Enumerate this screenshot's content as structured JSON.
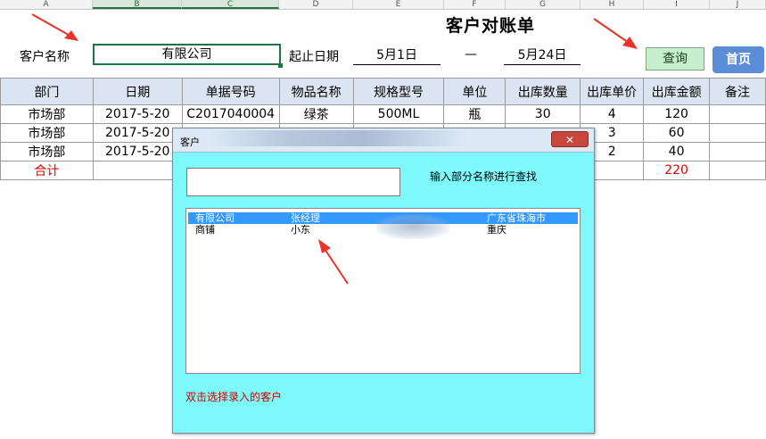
{
  "sheet": {
    "columns": [
      "A",
      "B",
      "C",
      "D",
      "E",
      "F",
      "G",
      "H",
      "I",
      "J"
    ],
    "selected_columns": [
      "B",
      "C"
    ]
  },
  "report": {
    "title": "客户对账单",
    "customer_label": "客户名称",
    "customer_value": "有限公司",
    "date_label": "起止日期",
    "date_start": "5月1日",
    "date_sep": "—",
    "date_end": "5月24日",
    "query_button": "查询",
    "home_button": "首页"
  },
  "table": {
    "headers": [
      "部门",
      "日期",
      "单据号码",
      "物品名称",
      "规格型号",
      "单位",
      "出库数量",
      "出库单价",
      "出库金额",
      "备注"
    ],
    "rows": [
      [
        "市场部",
        "2017-5-20",
        "C2017040004",
        "绿茶",
        "500ML",
        "瓶",
        "30",
        "4",
        "120",
        ""
      ],
      [
        "市场部",
        "2017-5-20",
        "",
        "",
        "",
        "",
        "",
        "3",
        "60",
        ""
      ],
      [
        "市场部",
        "2017-5-20",
        "",
        "",
        "",
        "",
        "",
        "2",
        "40",
        ""
      ]
    ],
    "total_label": "合计",
    "total_amount": "220"
  },
  "dialog": {
    "title": "客户",
    "close_icon": "close-icon",
    "hint": "输入部分名称进行查找",
    "search_value": "",
    "list": [
      {
        "name": "有限公司",
        "contact": "张经理",
        "address": "广东省珠海市",
        "selected": true
      },
      {
        "name": "商铺",
        "contact": "小东",
        "address": "重庆",
        "selected": false
      }
    ],
    "note": "双击选择录入的客户"
  },
  "colors": {
    "header_fill": "#dbe5f1",
    "query_fill": "#c6efce",
    "home_fill": "#5b8dd6",
    "dialog_fill": "#7ef9fb",
    "selection": "#3399ff",
    "annotation_red": "#e8322a"
  }
}
